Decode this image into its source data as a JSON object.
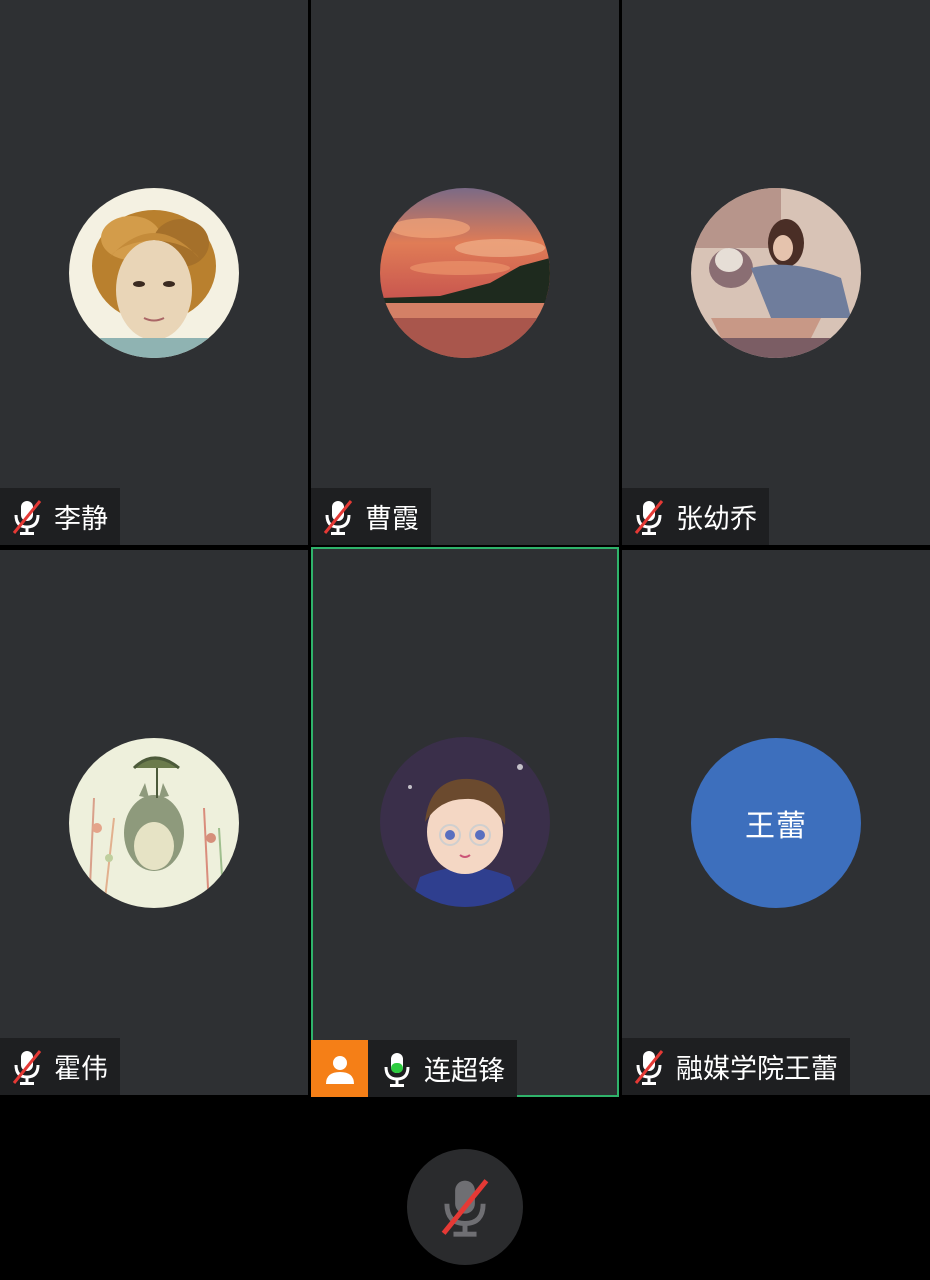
{
  "participants": [
    {
      "name": "李静",
      "mic": "muted",
      "avatar": "photo-curly-hair"
    },
    {
      "name": "曹霞",
      "mic": "muted",
      "avatar": "photo-sunset-lake"
    },
    {
      "name": "张幼乔",
      "mic": "muted",
      "avatar": "photo-woman-with-cat"
    },
    {
      "name": "霍伟",
      "mic": "muted",
      "avatar": "illustration-totoro"
    },
    {
      "name": "连超锋",
      "mic": "active",
      "host": true,
      "avatar": "illustration-cartoon-boy",
      "highlight_color": "#2fb36b"
    },
    {
      "name": "融媒学院王蕾",
      "mic": "muted",
      "avatar_text": "王蕾",
      "avatar_color": "#3d6fbd"
    }
  ],
  "controls": {
    "mic_button": "mic-muted-icon"
  },
  "colors": {
    "tile_bg": "#2e3033",
    "label_bg": "#1e1f21",
    "muted_slash": "#e53935",
    "active_mic": "#2ecc40",
    "host_badge": "#f57f17"
  }
}
